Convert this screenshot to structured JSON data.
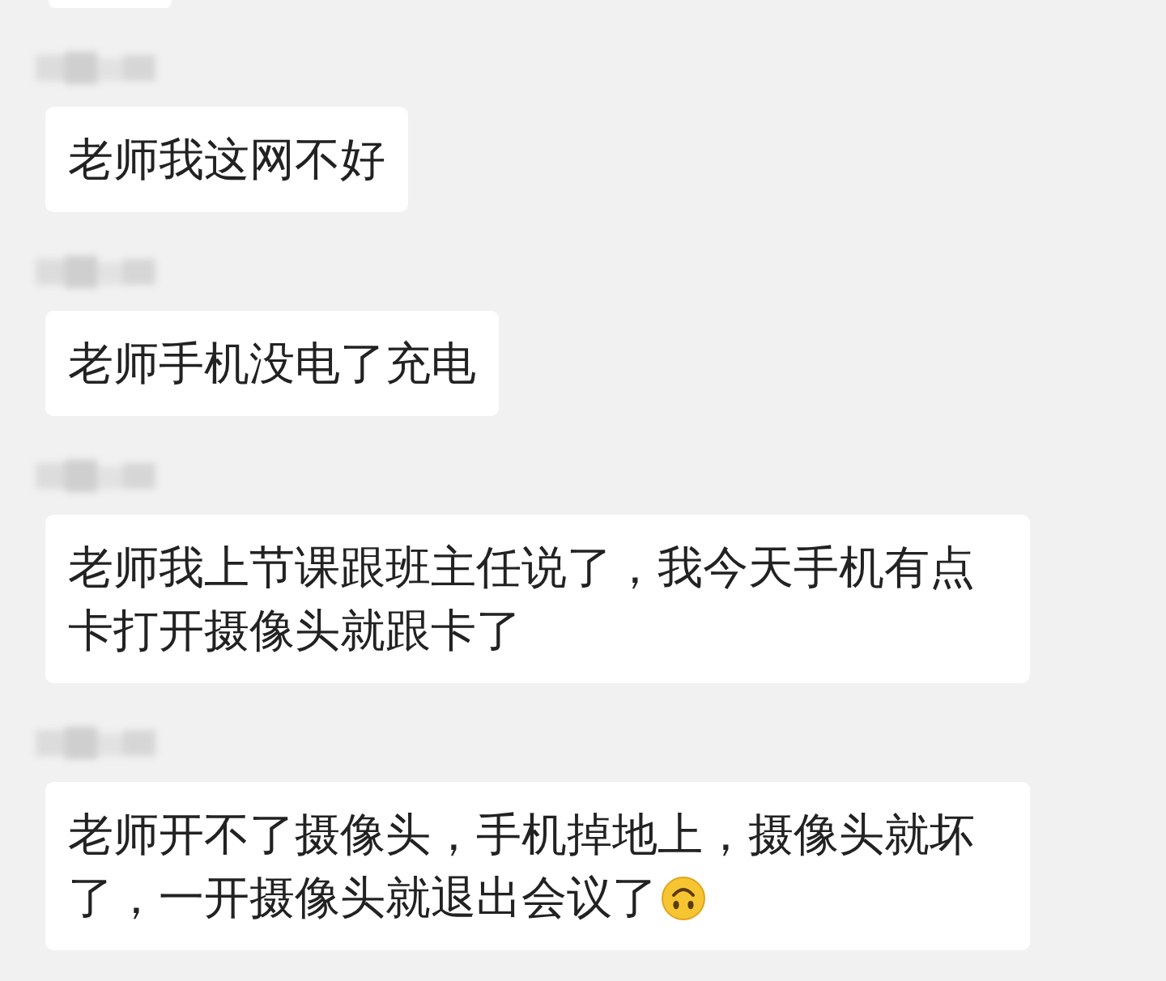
{
  "messages": [
    {
      "text": "老师我这网不好",
      "emoji": false
    },
    {
      "text": "老师手机没电了充电",
      "emoji": false
    },
    {
      "text": "老师我上节课跟班主任说了，我今天手机有点卡打开摄像头就跟卡了",
      "emoji": false
    },
    {
      "text": "老师开不了摄像头，手机掉地上，摄像头就坏了，一开摄像头就退出会议了",
      "emoji": true
    }
  ]
}
